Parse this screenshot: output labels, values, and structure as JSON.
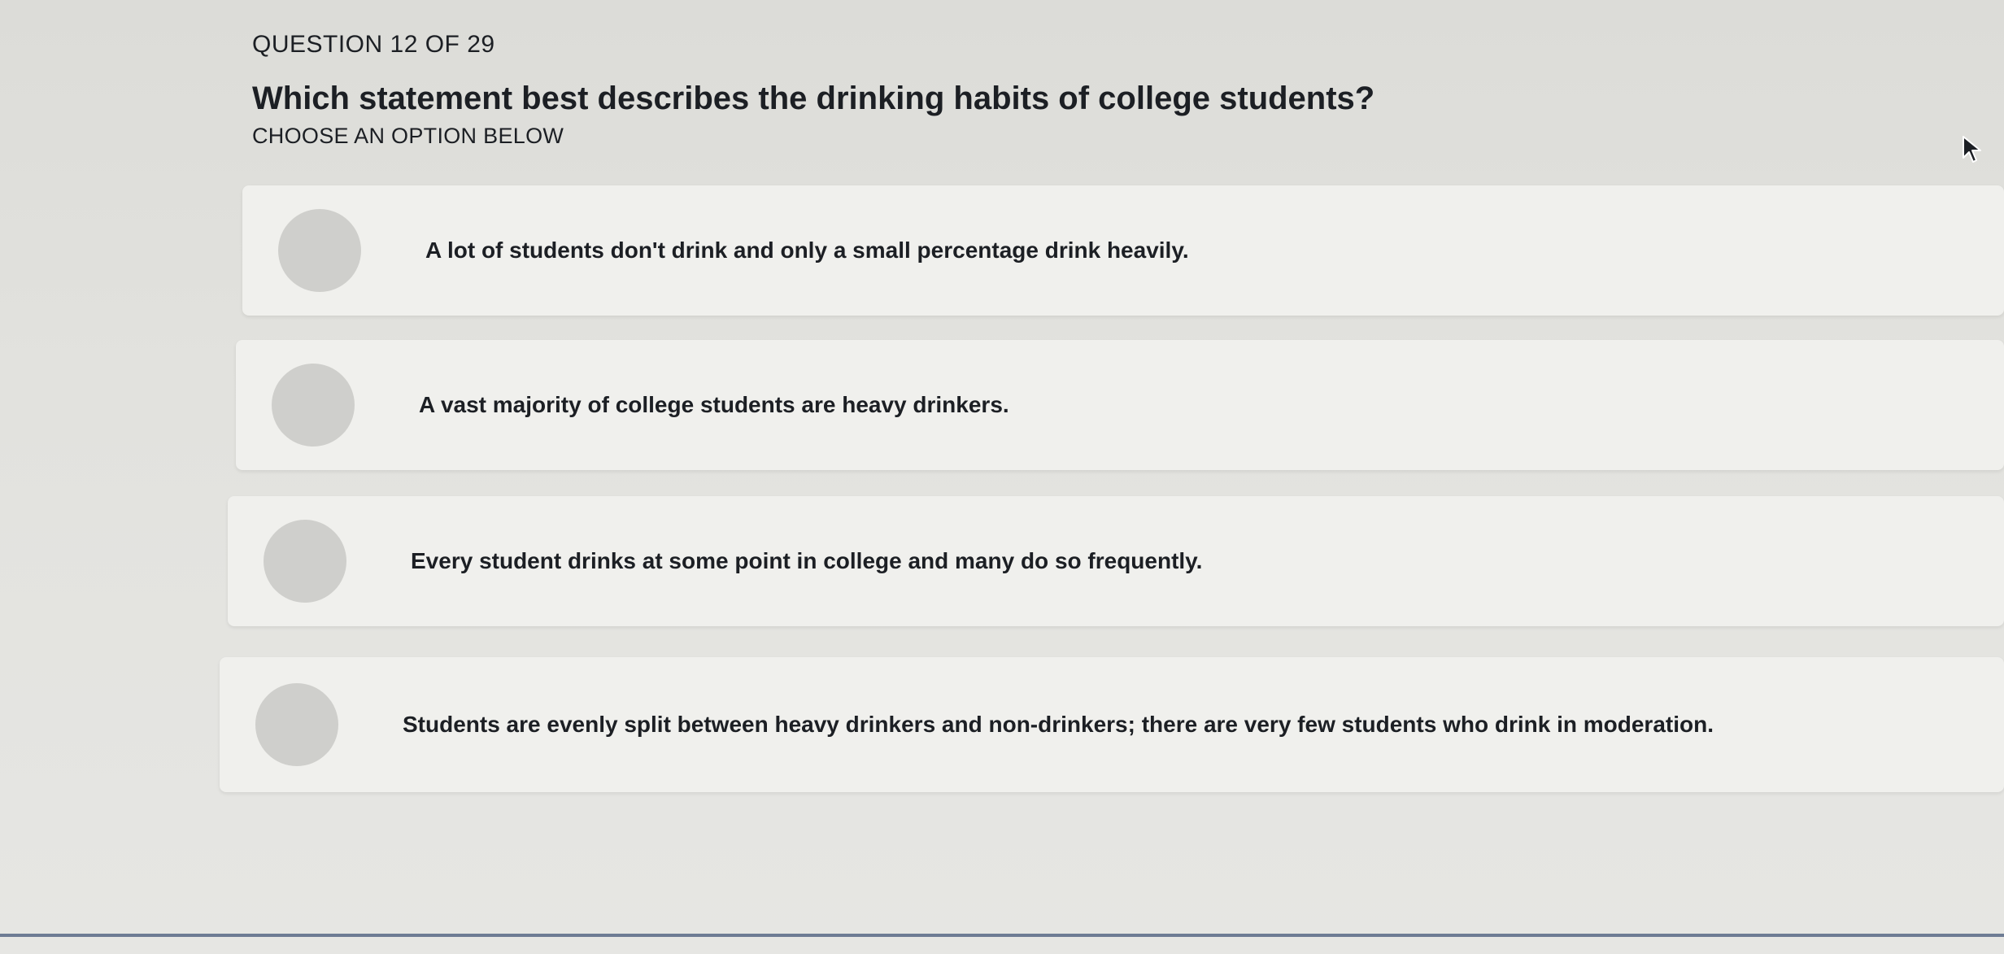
{
  "header": {
    "counter": "QUESTION 12 OF 29",
    "question": "Which statement best describes the drinking habits of college students?",
    "instruction": "CHOOSE AN OPTION BELOW"
  },
  "options": [
    {
      "label": "A lot of students don't drink and only a small percentage drink heavily."
    },
    {
      "label": "A vast majority of college students are heavy drinkers."
    },
    {
      "label": "Every student drinks at some point in college and many do so frequently."
    },
    {
      "label": "Students are evenly split between heavy drinkers and non-drinkers; there are very few students who drink in moderation."
    }
  ],
  "icons": {
    "cursor": "mouse-pointer-icon"
  },
  "colors": {
    "background": "#e2e2de",
    "card": "#f0f0ed",
    "radio": "#cfcfcc",
    "text": "#1c1f24",
    "bottom_rule": "#6e7c94"
  }
}
